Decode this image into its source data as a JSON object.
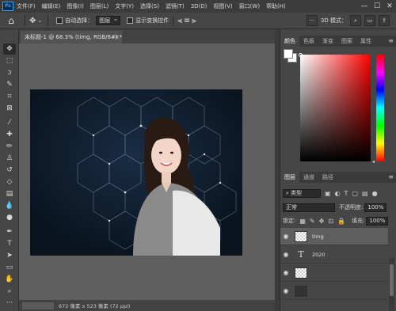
{
  "app": {
    "logo_text": "Ps"
  },
  "menu": [
    "文件(F)",
    "编辑(E)",
    "图像(I)",
    "图层(L)",
    "文字(Y)",
    "选择(S)",
    "滤镜(T)",
    "3D(D)",
    "视图(V)",
    "窗口(W)",
    "帮助(H)"
  ],
  "window_controls": {
    "minimize": "—",
    "maximize": "☐",
    "close": "✕"
  },
  "options_bar": {
    "auto_select_label": "自动选择：",
    "auto_select_value": "图层",
    "show_transform_label": "显示变换控件",
    "mode_3d_label": "3D 模式：",
    "more": "···"
  },
  "document": {
    "tab_title": "未标题-1 @ 68.3% (timg, RGB/8#) *",
    "close": "×"
  },
  "status": {
    "info": "672 像素 x 523 像素 (72 ppi)"
  },
  "color_panel": {
    "tabs": [
      "颜色",
      "色板",
      "渐变",
      "图案",
      "属性"
    ],
    "active_tab": 0,
    "foreground": "#ffffff",
    "background": "#ffffff"
  },
  "layers_panel": {
    "tabs": [
      "图层",
      "通道",
      "路径"
    ],
    "active_tab": 0,
    "filter_kind": "类型",
    "blend_mode": "正常",
    "opacity_label": "不透明度:",
    "opacity_value": "100%",
    "lock_label": "锁定:",
    "fill_label": "填充:",
    "fill_value": "100%",
    "layers": [
      {
        "name": "timg",
        "type": "smart",
        "selected": true
      },
      {
        "name": "2020",
        "type": "text",
        "selected": false
      },
      {
        "name": "",
        "type": "raster",
        "selected": false
      },
      {
        "name": "",
        "type": "raster",
        "selected": false
      }
    ]
  },
  "tools": [
    "move",
    "marquee",
    "lasso",
    "quick-select",
    "crop",
    "frame",
    "eyedropper",
    "healing",
    "brush",
    "clone",
    "history-brush",
    "eraser",
    "gradient",
    "blur",
    "dodge",
    "pen",
    "type",
    "path-select",
    "rectangle",
    "hand",
    "zoom",
    "more"
  ],
  "colors": {
    "canvas_bg": "#0c1a2b",
    "hex_line": "#7a8aa0"
  }
}
